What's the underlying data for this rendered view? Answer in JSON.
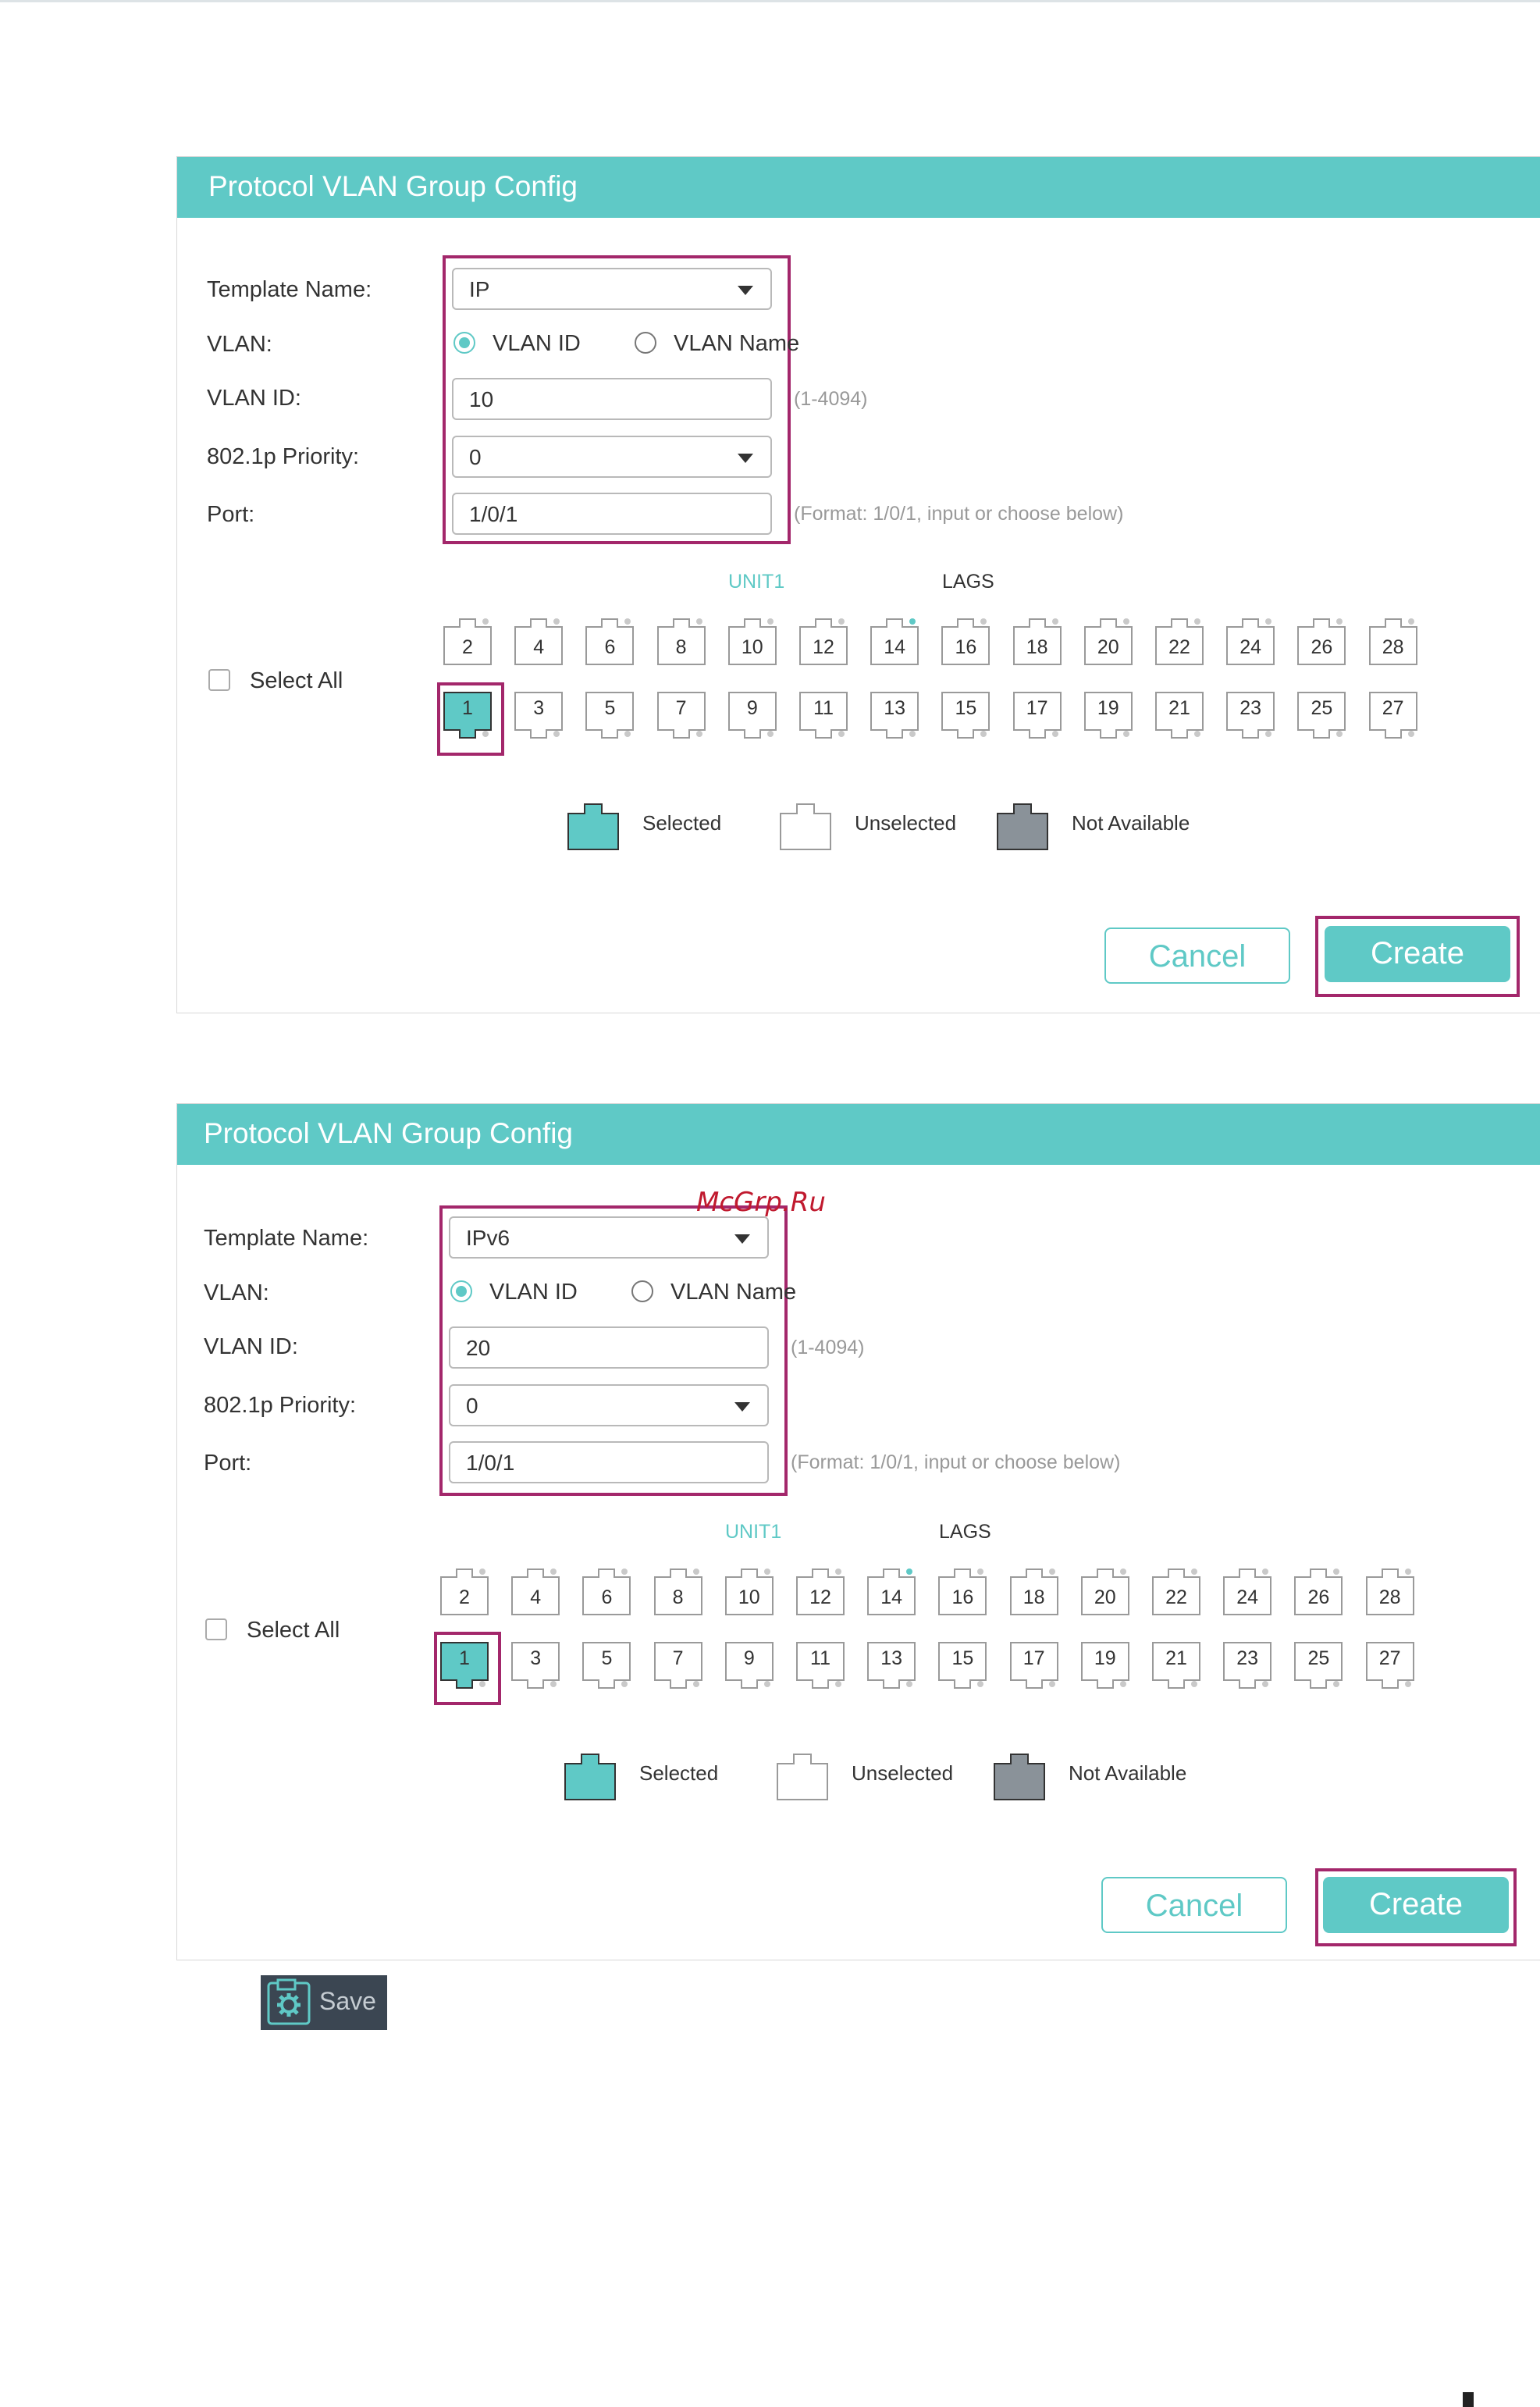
{
  "panels": [
    {
      "title": "Protocol VLAN Group Config",
      "labels": {
        "template": "Template Name:",
        "vlan": "VLAN:",
        "vlan_id": "VLAN ID:",
        "priority": "802.1p Priority:",
        "port": "Port:"
      },
      "template_value": "IP",
      "radio_vlan_id": "VLAN ID",
      "radio_vlan_name": "VLAN Name",
      "vlan_id_value": "10",
      "vlan_id_hint": "(1-4094)",
      "priority_value": "0",
      "port_value": "1/0/1",
      "port_hint": "(Format: 1/0/1, input or choose below)",
      "unit_label": "UNIT1",
      "lags_label": "LAGS",
      "select_all": "Select All",
      "legend": {
        "selected": "Selected",
        "unselected": "Unselected",
        "not_available": "Not Available"
      },
      "cancel": "Cancel",
      "create": "Create"
    },
    {
      "title": "Protocol VLAN Group Config",
      "labels": {
        "template": "Template Name:",
        "vlan": "VLAN:",
        "vlan_id": "VLAN ID:",
        "priority": "802.1p Priority:",
        "port": "Port:"
      },
      "template_value": "IPv6",
      "radio_vlan_id": "VLAN ID",
      "radio_vlan_name": "VLAN Name",
      "vlan_id_value": "20",
      "vlan_id_hint": "(1-4094)",
      "priority_value": "0",
      "port_value": "1/0/1",
      "port_hint": "(Format: 1/0/1, input or choose below)",
      "unit_label": "UNIT1",
      "lags_label": "LAGS",
      "select_all": "Select All",
      "legend": {
        "selected": "Selected",
        "unselected": "Unselected",
        "not_available": "Not Available"
      },
      "cancel": "Cancel",
      "create": "Create"
    }
  ],
  "ports_top": [
    "2",
    "4",
    "6",
    "8",
    "10",
    "12",
    "14",
    "16",
    "18",
    "20",
    "22",
    "24",
    "26",
    "28"
  ],
  "ports_bottom": [
    "1",
    "3",
    "5",
    "7",
    "9",
    "11",
    "13",
    "15",
    "17",
    "19",
    "21",
    "23",
    "25",
    "27"
  ],
  "selected_port": "1",
  "active_dot_port": "14",
  "watermark": "McGrp.Ru",
  "save_label": "Save",
  "colors": {
    "accent": "#5fc9c6",
    "highlight": "#a3276b",
    "not_available": "#8a9299"
  }
}
